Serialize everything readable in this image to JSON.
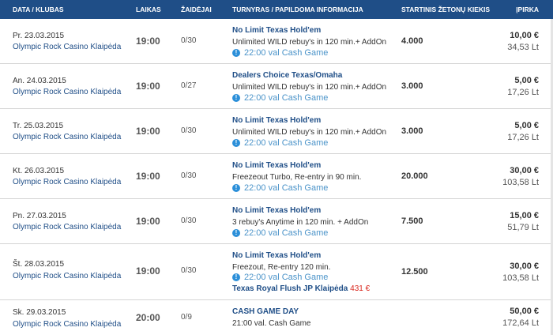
{
  "header": {
    "date_venue": "DATA / KLUBAS",
    "time": "LAIKAS",
    "players": "ŽAIDĖJAI",
    "tournament": "TURNYRAS / PAPILDOMA INFORMACIJA",
    "chips": "STARTINIS ŽETONŲ KIEKIS",
    "buyin": "ĮPIRKA"
  },
  "rows": [
    {
      "date": "Pr. 23.03.2015",
      "venue": "Olympic Rock Casino Klaipėda",
      "time": "19:00",
      "players": "0/30",
      "title": "No Limit Texas Hold'em",
      "detail": "Unlimited WILD   rebuy's in 120 min.+ AddOn",
      "cash": "22:00 val Cash Game",
      "chips": "4.000",
      "eur": "10,00 €",
      "ltl": "34,53 Lt"
    },
    {
      "date": "An. 24.03.2015",
      "venue": "Olympic Rock Casino Klaipėda",
      "time": "19:00",
      "players": "0/27",
      "title": "Dealers Choice Texas/Omaha",
      "detail": "Unlimited WILD   rebuy's in 120 min.+ AddOn",
      "cash": "22:00 val Cash Game",
      "chips": "3.000",
      "eur": "5,00 €",
      "ltl": "17,26 Lt"
    },
    {
      "date": "Tr. 25.03.2015",
      "venue": "Olympic Rock Casino Klaipėda",
      "time": "19:00",
      "players": "0/30",
      "title": "No Limit Texas Hold'em",
      "detail": "Unlimited WILD   rebuy's in 120 min.+ AddOn",
      "cash": "22:00 val Cash Game",
      "chips": "3.000",
      "eur": "5,00 €",
      "ltl": "17,26 Lt"
    },
    {
      "date": "Kt. 26.03.2015",
      "venue": "Olympic Rock Casino Klaipėda",
      "time": "19:00",
      "players": "0/30",
      "title": "No Limit Texas Hold'em",
      "detail": "Freezeout Turbo, Re-entry in 90 min.",
      "cash": "22:00 val Cash Game",
      "chips": "20.000",
      "eur": "30,00 €",
      "ltl": "103,58 Lt"
    },
    {
      "date": "Pn. 27.03.2015",
      "venue": "Olympic Rock Casino Klaipėda",
      "time": "19:00",
      "players": "0/30",
      "title": "No Limit Texas Hold'em",
      "detail": "3 rebuy's Anytime in 120 min. + AddOn",
      "cash": "22:00 val Cash Game",
      "chips": "7.500",
      "eur": "15,00 €",
      "ltl": "51,79 Lt"
    },
    {
      "date": "Št. 28.03.2015",
      "venue": "Olympic Rock Casino Klaipėda",
      "time": "19:00",
      "players": "0/30",
      "title": "No Limit Texas Hold'em",
      "detail": "Freezout, Re-entry 120 min.",
      "cash": "22:00 val Cash Game",
      "jp_label": "Texas Royal Flush JP Klaipėda",
      "jp_amount": "431 €",
      "chips": "12.500",
      "eur": "30,00 €",
      "ltl": "103,58 Lt"
    },
    {
      "date": "Sk. 29.03.2015",
      "venue": "Olympic Rock Casino Klaipėda",
      "time": "20:00",
      "players": "0/9",
      "title": "CASH GAME DAY",
      "detail": "21:00 val. Cash Game",
      "chips": "",
      "eur": "50,00 €",
      "ltl": "172,64 Lt"
    }
  ],
  "colors": {
    "header_bg": "#1f4e87",
    "link": "#1f4e87",
    "cash": "#4a93c9",
    "jackpot": "#d9261c"
  },
  "icons": {
    "cash_game": "info-circle-icon"
  }
}
